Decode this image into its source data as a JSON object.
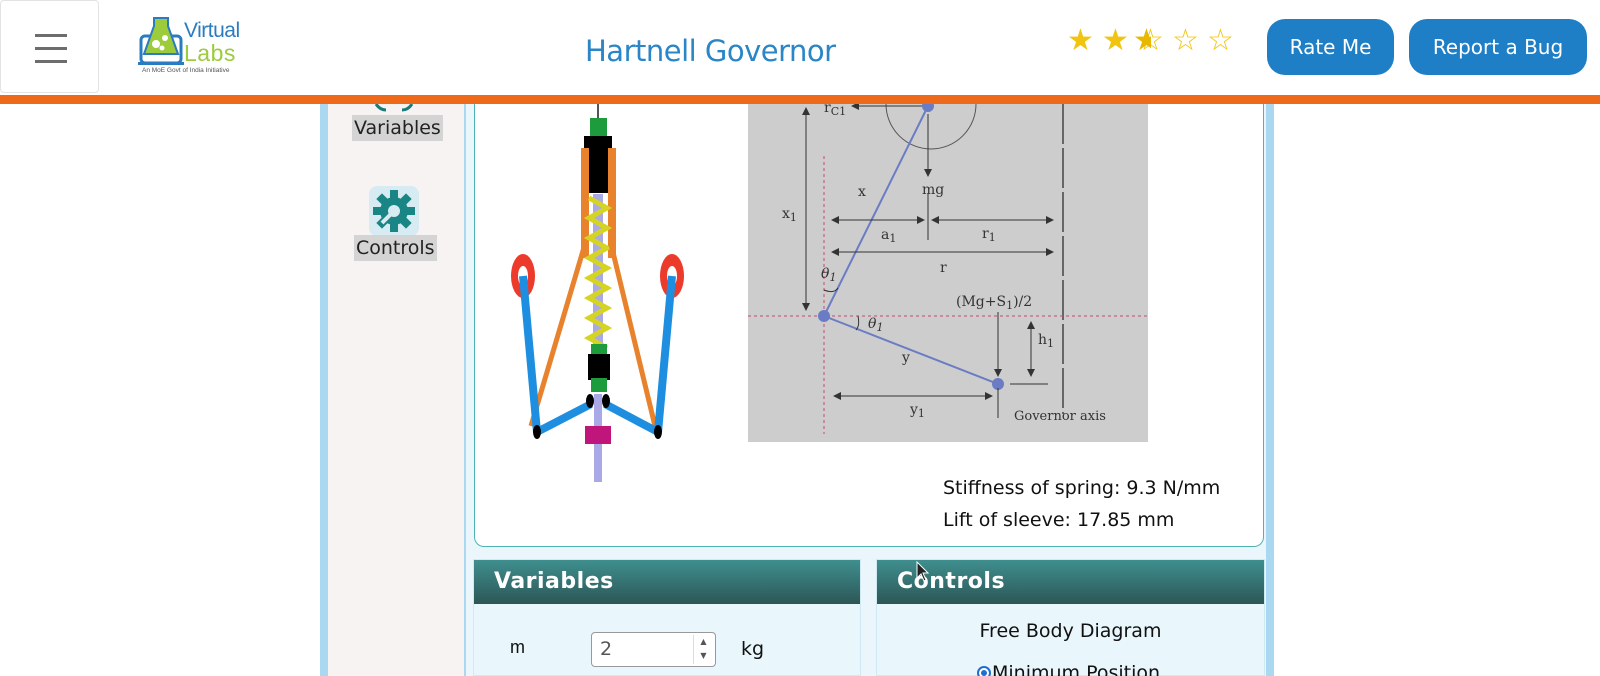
{
  "header": {
    "menu_icon": "hamburger-icon",
    "logo": {
      "word1": "Virtual",
      "word2": "Labs",
      "tagline": "An MoE Govt of India Initiative"
    },
    "title": "Hartnell Governor",
    "rating": {
      "value": 2.5,
      "max": 5,
      "color": "#f1c40f"
    },
    "rate_button": "Rate Me",
    "bug_button": "Report a Bug",
    "accent_color": "#ee6a1a",
    "button_color": "#1e7fc6"
  },
  "sidebar": {
    "items": [
      {
        "label": "Variables",
        "icon": "variables-icon"
      },
      {
        "label": "Controls",
        "icon": "gear-wrench-icon"
      }
    ]
  },
  "diagram": {
    "labels": {
      "rc": "r",
      "rc_sub": "C1",
      "mg": "mg",
      "x1": "x",
      "x1_sub": "1",
      "x": "x",
      "a1": "a",
      "a1_sub": "1",
      "r1": "r",
      "r1_sub": "1",
      "r": "r",
      "theta1a": "θ",
      "theta1a_sub": "1",
      "theta1b": "θ",
      "theta1b_sub": "1",
      "force": "(Mg+S",
      "force_sub": "1",
      "force_end": ")/2",
      "h1": "h",
      "h1_sub": "1",
      "y": "y",
      "y1": "y",
      "y1_sub": "1",
      "axis": "Governor axis"
    }
  },
  "readouts": {
    "stiffness": "Stiffness of spring: 9.3 N/mm",
    "lift": "Lift of sleeve: 17.85 mm"
  },
  "variables_card": {
    "title": "Variables",
    "var_name": "m",
    "var_value": "2",
    "var_unit": "kg"
  },
  "controls_card": {
    "title": "Controls",
    "subtitle": "Free Body Diagram",
    "radio_label": "Minimum Position"
  }
}
